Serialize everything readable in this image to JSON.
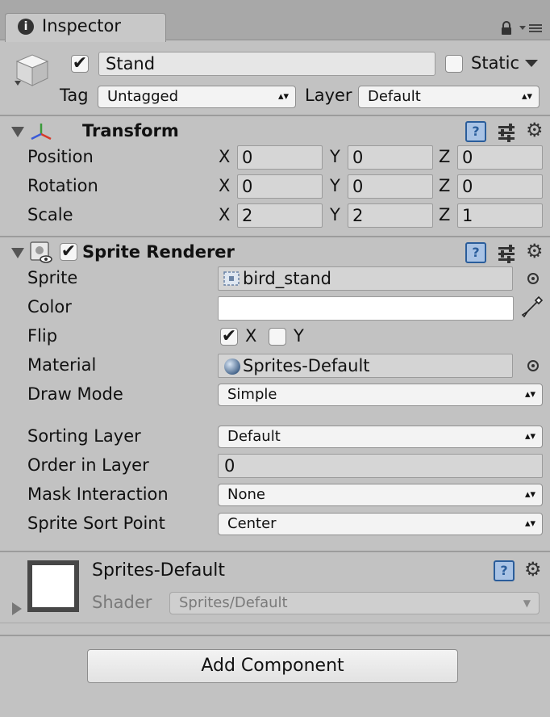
{
  "tab": {
    "label": "Inspector"
  },
  "header": {
    "name_value": "Stand",
    "active_checked": true,
    "static_label": "Static",
    "static_checked": false,
    "tag_label": "Tag",
    "tag_value": "Untagged",
    "layer_label": "Layer",
    "layer_value": "Default"
  },
  "transform": {
    "title": "Transform",
    "rows": [
      {
        "label": "Position",
        "x": "0",
        "y": "0",
        "z": "0"
      },
      {
        "label": "Rotation",
        "x": "0",
        "y": "0",
        "z": "0"
      },
      {
        "label": "Scale",
        "x": "2",
        "y": "2",
        "z": "1"
      }
    ],
    "axis": {
      "x": "X",
      "y": "Y",
      "z": "Z"
    }
  },
  "sprite_renderer": {
    "title": "Sprite Renderer",
    "enabled": true,
    "sprite_label": "Sprite",
    "sprite_value": "bird_stand",
    "color_label": "Color",
    "color_value": "#ffffff",
    "flip_label": "Flip",
    "flip_x_label": "X",
    "flip_x_checked": true,
    "flip_y_label": "Y",
    "flip_y_checked": false,
    "material_label": "Material",
    "material_value": "Sprites-Default",
    "draw_mode_label": "Draw Mode",
    "draw_mode_value": "Simple",
    "sorting_layer_label": "Sorting Layer",
    "sorting_layer_value": "Default",
    "order_label": "Order in Layer",
    "order_value": "0",
    "mask_label": "Mask Interaction",
    "mask_value": "None",
    "sort_point_label": "Sprite Sort Point",
    "sort_point_value": "Center"
  },
  "material": {
    "name": "Sprites-Default",
    "shader_label": "Shader",
    "shader_value": "Sprites/Default"
  },
  "add_component_label": "Add Component",
  "icons": {
    "tab": "info-icon",
    "lock": "lock-icon",
    "menu": "tab-menu-icon",
    "gameobject": "cube-icon",
    "transform": "transform-axes-icon",
    "sprite_renderer": "sprite-renderer-icon",
    "help": "help-icon",
    "preset": "preset-sliders-icon",
    "gear": "gear-icon",
    "picker": "object-picker-icon",
    "eyedropper": "eyedropper-icon"
  },
  "colors": {
    "background": "#c2c2c2",
    "tabbar": "#a8a8a8",
    "help_accent": "#2a5d9b"
  }
}
